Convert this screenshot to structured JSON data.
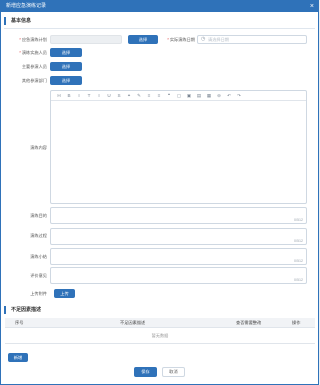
{
  "dialog": {
    "title": "新增应急演练记录",
    "close_icon": "close-icon"
  },
  "basic_info": {
    "heading": "基本信息",
    "plan_label": "应急演练计划",
    "plan_value": "",
    "select_label": "选择",
    "date_label": "实际演练日期",
    "date_placeholder": "请选择日期",
    "participants_label": "演练实施人员",
    "main_participants_label": "主要参演人员",
    "other_departments_label": "其他参演部门",
    "content_label": "演练内容",
    "purpose_label": "演练目的",
    "process_label": "演练过程",
    "summary_label": "演练小结",
    "evaluation_label": "评价意见",
    "attachment_label": "上传附件",
    "upload_label": "上传",
    "counter": "0/512"
  },
  "toolbar": {
    "icons": [
      "H",
      "B",
      "I",
      "T",
      "I",
      "U",
      "S",
      "⚭",
      "✎",
      "≡",
      "≡",
      "❝",
      "▢",
      "▣",
      "▤",
      "▦",
      "⊖",
      "↶",
      "↷"
    ]
  },
  "nonconformity": {
    "heading": "不足因素描述",
    "columns": [
      "序号",
      "不足因素描述",
      "查否需要整改",
      "操作"
    ],
    "empty_text": "暂无数据",
    "add_label": "新增"
  },
  "footer": {
    "save_label": "保存",
    "cancel_label": "取消"
  },
  "colors": {
    "primary": "#2f72b9",
    "required": "#e03c3c"
  }
}
